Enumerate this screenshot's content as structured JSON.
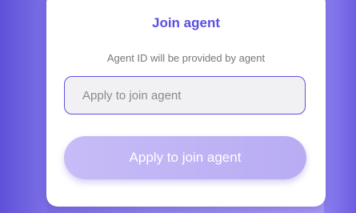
{
  "dialog": {
    "title": "Join agent",
    "hint": "Agent ID will be provided by agent",
    "agent_id_input": {
      "value": "",
      "placeholder": "Apply to join agent"
    },
    "apply_button_label": "Apply to join agent",
    "apply_button_state": "disabled"
  },
  "colors": {
    "accent": "#5a4fe0",
    "input_border": "#5e52de",
    "button_disabled": "#c2b6f6",
    "hint_text": "#777777"
  }
}
